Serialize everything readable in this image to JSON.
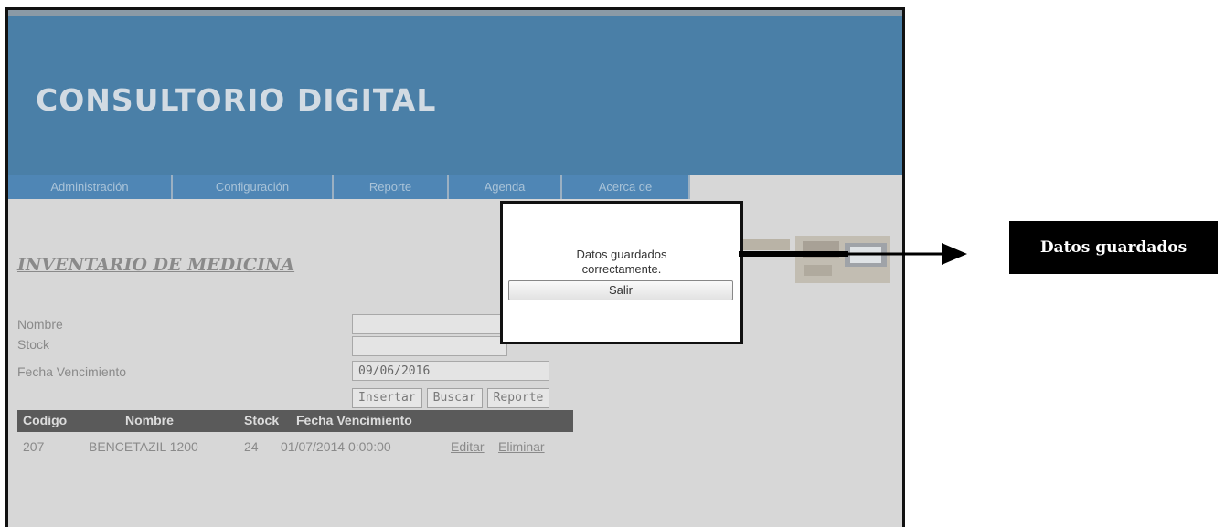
{
  "app": {
    "brand": "CONSULTORIO DIGITAL",
    "colors": {
      "header": "#4a7fa7",
      "menu": "#4f86b5",
      "content_bg": "#d7d7d7",
      "table_header": "#5a5a5a"
    }
  },
  "menu": {
    "items": [
      {
        "label": "Administración"
      },
      {
        "label": "Configuración"
      },
      {
        "label": "Reporte"
      },
      {
        "label": "Agenda"
      },
      {
        "label": "Acerca de"
      }
    ]
  },
  "page": {
    "title": "INVENTARIO DE MEDICINA"
  },
  "form": {
    "nombre": {
      "label": "Nombre",
      "value": ""
    },
    "stock": {
      "label": "Stock",
      "value": ""
    },
    "fecha": {
      "label": "Fecha Vencimiento",
      "value": "09/06/2016"
    },
    "buttons": {
      "insertar": "Insertar",
      "buscar": "Buscar",
      "reporte": "Reporte"
    }
  },
  "table": {
    "headers": [
      "Codigo",
      "Nombre",
      "Stock",
      "Fecha Vencimiento"
    ],
    "rows": [
      {
        "codigo": "207",
        "nombre": "BENCETAZIL 1200",
        "stock": "24",
        "fecha": "01/07/2014 0:00:00",
        "editar": "Editar",
        "eliminar": "Eliminar"
      }
    ]
  },
  "dialog": {
    "message_line1": "Datos guardados",
    "message_line2": "correctamente.",
    "button": "Salir"
  },
  "callout": {
    "label": "Datos guardados"
  }
}
